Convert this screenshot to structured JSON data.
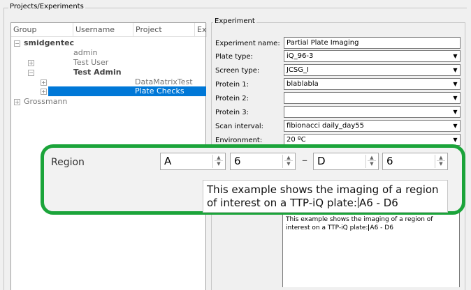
{
  "projects_panel": {
    "title": "Projects/Experiments",
    "columns": [
      "Group",
      "Username",
      "Project",
      "Ex"
    ],
    "tree": [
      {
        "label": "smidgentec",
        "expander": "⊟"
      },
      {
        "label": "admin"
      },
      {
        "label": "Test User",
        "expander": "⊞"
      },
      {
        "label": "Test Admin",
        "expander": "⊟"
      },
      {
        "label": "DataMatrixTest",
        "expander": "⊞"
      },
      {
        "label": "Plate Checks",
        "expander": "⊞",
        "selected": true
      },
      {
        "label": "Grossmann",
        "expander": "⊞"
      }
    ]
  },
  "experiment": {
    "title": "Experiment",
    "fields": [
      {
        "label": "Experiment name:",
        "value": "Partial Plate Imaging",
        "type": "text"
      },
      {
        "label": "Plate type:",
        "value": "iQ_96-3",
        "type": "dropdown"
      },
      {
        "label": "Screen type:",
        "value": "JCSG_I",
        "type": "dropdown"
      },
      {
        "label": "Protein 1:",
        "value": "blablabla",
        "type": "dropdown"
      },
      {
        "label": "Protein 2:",
        "value": "",
        "type": "dropdown"
      },
      {
        "label": "Protein 3:",
        "value": "",
        "type": "dropdown"
      },
      {
        "label": "Scan interval:",
        "value": "fibionacci daily_day55",
        "type": "dropdown"
      },
      {
        "label": "Environment:",
        "value": "20 ºC",
        "type": "dropdown"
      }
    ],
    "description_before_caret": "This example shows the imaging of a region of interest on a TTP-iQ plate:",
    "description_after_caret": "A6 - D6"
  },
  "region": {
    "label": "Region",
    "from_row": "A",
    "from_col": "6",
    "separator": "–",
    "to_row": "D",
    "to_col": "6",
    "text_before_caret": "This example shows the imaging of a region of interest on a TTP-iQ plate:",
    "text_after_caret": "A6 - D6"
  },
  "colors": {
    "highlight_border": "#1ba43a",
    "selection": "#0078d7"
  },
  "icons": {
    "dropdown": "chevron-down-icon",
    "spin_up": "▲",
    "spin_down": "▼",
    "dropdown_glyph": "▼"
  }
}
